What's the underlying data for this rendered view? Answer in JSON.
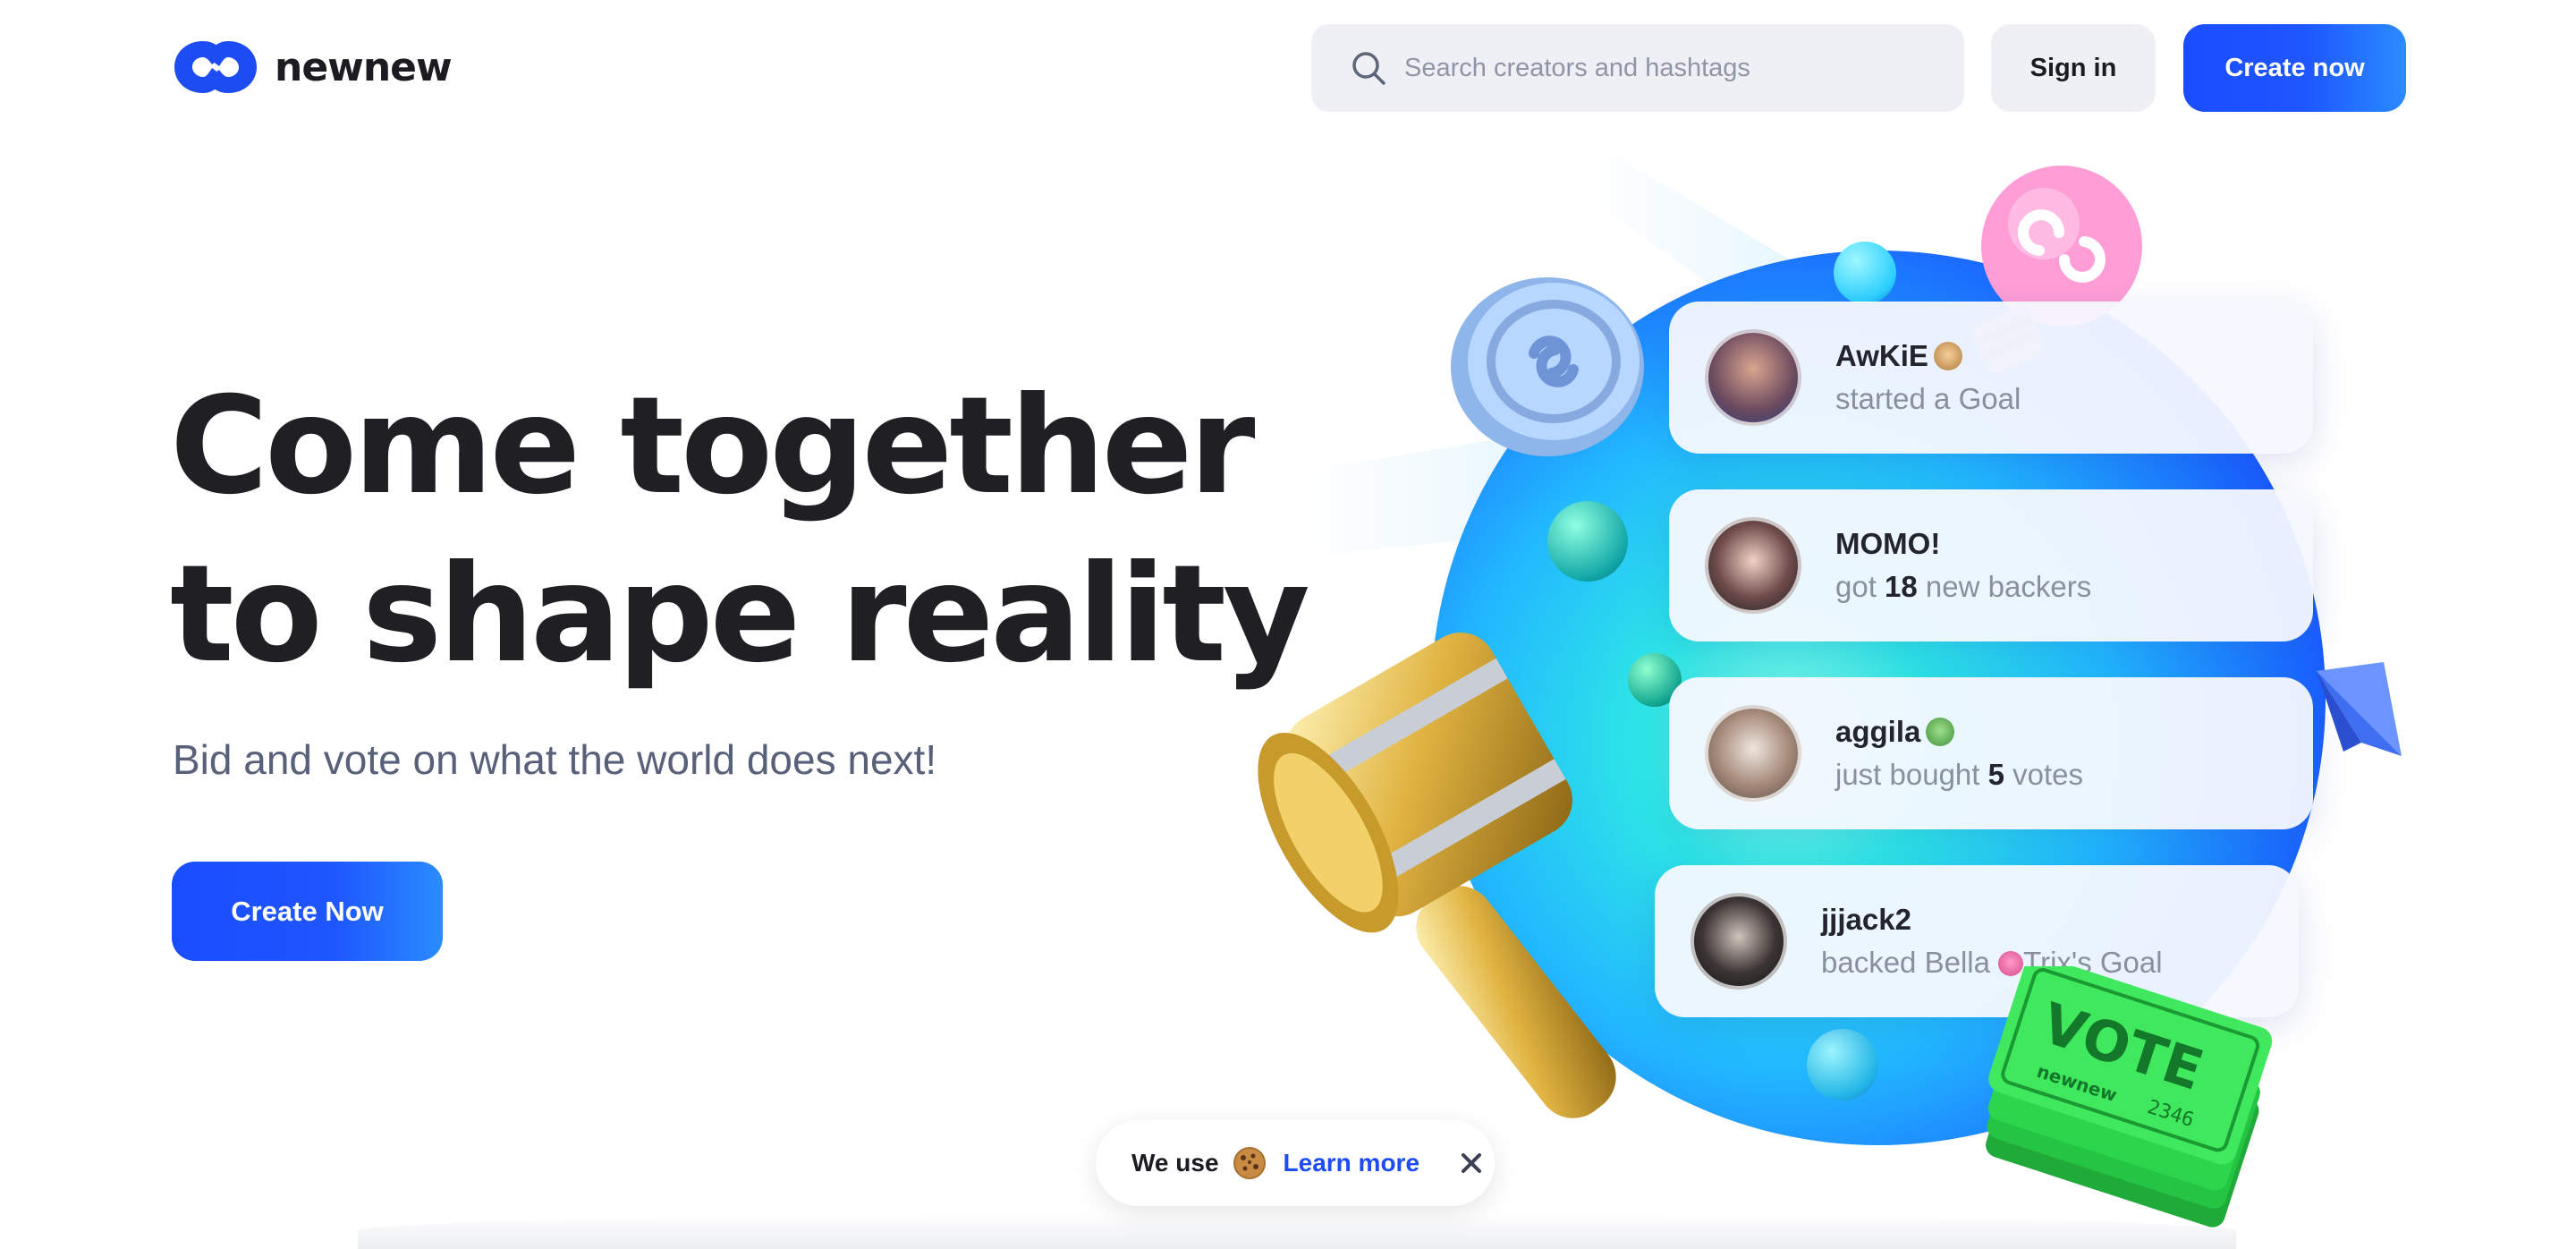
{
  "header": {
    "brand_name": "newnew",
    "search_placeholder": "Search creators and hashtags",
    "signin_label": "Sign in",
    "create_label": "Create now"
  },
  "hero": {
    "title_line1": "Come together",
    "title_line2": "to shape reality",
    "subtitle": "Bid and vote on what the world does next!",
    "cta_label": "Create Now"
  },
  "activity": [
    {
      "name": "AwKiE",
      "action_pre": "started a Goal",
      "action_bold": "",
      "action_post": ""
    },
    {
      "name": "MOMO!",
      "action_pre": "got ",
      "action_bold": "18",
      "action_post": " new backers"
    },
    {
      "name": "aggila",
      "action_pre": "just bought ",
      "action_bold": "5",
      "action_post": " votes"
    },
    {
      "name": "jjjack2",
      "action_pre": "backed Bella",
      "action_bold": "",
      "action_post": "Trix's Goal"
    }
  ],
  "illustration": {
    "ticket_text": "VOTE",
    "ticket_brand": "newnew",
    "ticket_number": "2346"
  },
  "cookie": {
    "text": "We use",
    "link_label": "Learn more"
  },
  "colors": {
    "brand_blue": "#1D4CF2",
    "text_dark": "#1F1F24",
    "subtitle": "#59607A",
    "search_bg": "#EEF0F5"
  }
}
